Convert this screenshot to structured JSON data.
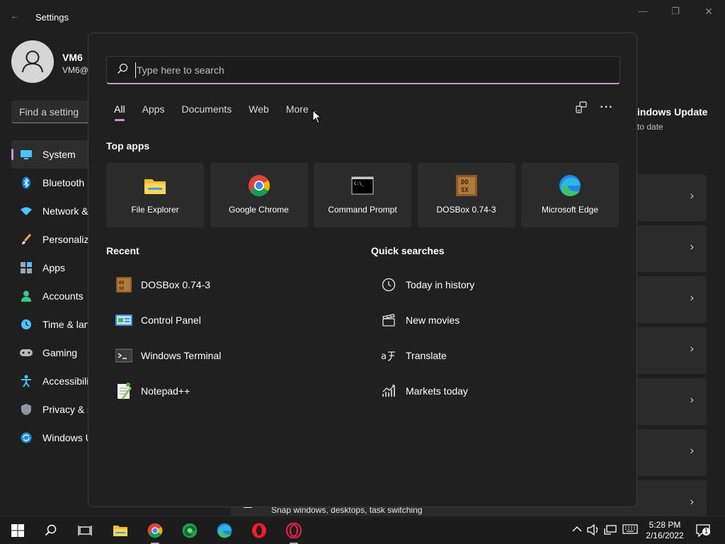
{
  "window": {
    "title": "Settings",
    "back_glyph": "←",
    "minimize_glyph": "—",
    "maximize_glyph": "❐",
    "close_glyph": "✕"
  },
  "user": {
    "name": "VM6",
    "email": "VM6@"
  },
  "find_setting": {
    "placeholder": "Find a setting"
  },
  "nav": {
    "items": [
      {
        "label": "System",
        "icon": "monitor-icon"
      },
      {
        "label": "Bluetooth",
        "icon": "bluetooth-icon"
      },
      {
        "label": "Network &",
        "icon": "wifi-icon"
      },
      {
        "label": "Personaliz",
        "icon": "brush-icon"
      },
      {
        "label": "Apps",
        "icon": "apps-icon"
      },
      {
        "label": "Accounts",
        "icon": "person-icon"
      },
      {
        "label": "Time & lan",
        "icon": "clock-icon"
      },
      {
        "label": "Gaming",
        "icon": "gamepad-icon"
      },
      {
        "label": "Accessibili",
        "icon": "accessibility-icon"
      },
      {
        "label": "Privacy & s",
        "icon": "shield-icon"
      },
      {
        "label": "Windows U",
        "icon": "update-icon"
      }
    ]
  },
  "windows_update": {
    "title": "indows Update",
    "subtitle": "to date"
  },
  "snap_row": {
    "label": "Snap windows, desktops, task switching"
  },
  "search": {
    "placeholder": "Type here to search",
    "value": "",
    "filters": [
      "All",
      "Apps",
      "Documents",
      "Web",
      "More"
    ],
    "active_filter": "All",
    "more_chevron": "⌄",
    "options_glyph": "···"
  },
  "top_apps": {
    "title": "Top apps",
    "items": [
      {
        "label": "File Explorer",
        "icon": "folder-icon"
      },
      {
        "label": "Google Chrome",
        "icon": "chrome-icon"
      },
      {
        "label": "Command Prompt",
        "icon": "cmd-icon"
      },
      {
        "label": "DOSBox 0.74-3",
        "icon": "dosbox-icon"
      },
      {
        "label": "Microsoft Edge",
        "icon": "edge-icon"
      }
    ]
  },
  "recent": {
    "title": "Recent",
    "items": [
      {
        "label": "DOSBox 0.74-3",
        "icon": "dosbox-icon"
      },
      {
        "label": "Control Panel",
        "icon": "control-panel-icon"
      },
      {
        "label": "Windows Terminal",
        "icon": "terminal-icon"
      },
      {
        "label": "Notepad++",
        "icon": "notepad-icon"
      }
    ]
  },
  "quick_searches": {
    "title": "Quick searches",
    "items": [
      {
        "label": "Today in history",
        "icon": "clock-icon"
      },
      {
        "label": "New movies",
        "icon": "clapper-icon"
      },
      {
        "label": "Translate",
        "icon": "translate-icon"
      },
      {
        "label": "Markets today",
        "icon": "chart-icon"
      }
    ]
  },
  "taskbar": {
    "time": "5:28 PM",
    "date": "2/16/2022",
    "notification_count": "1"
  },
  "colors": {
    "accent": "#c493d6",
    "flyout_bg": "#202020",
    "tile_bg": "#2b2b2b"
  }
}
